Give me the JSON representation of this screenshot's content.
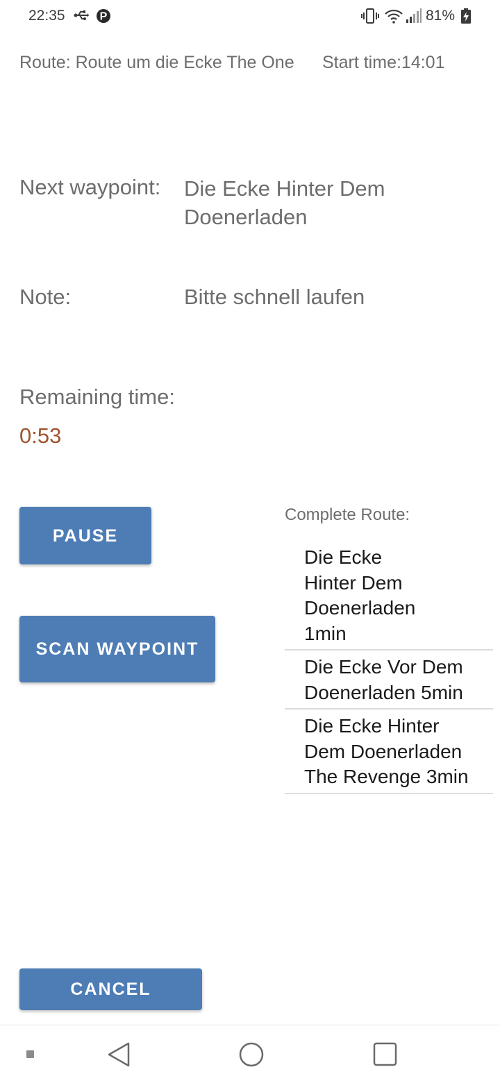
{
  "status_bar": {
    "time": "22:35",
    "battery": "81%",
    "icons": [
      "usb-icon",
      "parking-icon",
      "vibrate-icon",
      "wifi-icon",
      "signal-icon",
      "battery-icon"
    ]
  },
  "header": {
    "route": "Route: Route um die Ecke The One",
    "start_time": "Start time:14:01"
  },
  "next_waypoint": {
    "label": "Next waypoint:",
    "value": "Die Ecke Hinter Dem Doenerladen"
  },
  "note": {
    "label": "Note:",
    "value": "Bitte schnell laufen"
  },
  "remaining": {
    "label": "Remaining time:",
    "value": "0:53"
  },
  "buttons": {
    "pause": "PAUSE",
    "scan": "SCAN WAYPOINT",
    "cancel": "CANCEL"
  },
  "complete_route": {
    "title": "Complete Route:",
    "items": [
      "Die Ecke Hinter Dem Doenerladen 1min",
      "Die Ecke Vor Dem Doenerladen 5min",
      "Die Ecke Hinter Dem Doenerladen The Revenge 3min"
    ]
  },
  "nav_bar": {
    "icons": [
      "menu-icon",
      "back-icon",
      "home-icon",
      "recent-apps-icon"
    ]
  },
  "colors": {
    "button": "#4e7db5",
    "remaining_time": "#a0522d",
    "secondary_text": "#6d6d6d"
  }
}
